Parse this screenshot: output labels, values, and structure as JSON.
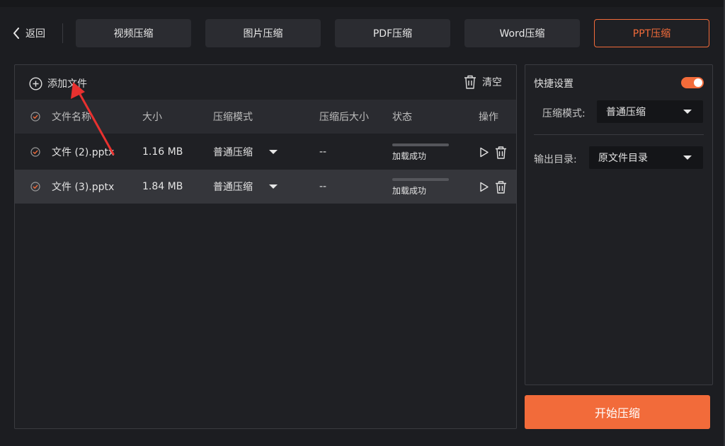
{
  "nav": {
    "back_label": "返回",
    "tabs": [
      {
        "label": "视频压缩"
      },
      {
        "label": "图片压缩"
      },
      {
        "label": "PDF压缩"
      },
      {
        "label": "Word压缩"
      },
      {
        "label": "PPT压缩"
      }
    ],
    "active_tab": "PPT压缩"
  },
  "toolbar": {
    "add_file_label": "添加文件",
    "clear_label": "清空"
  },
  "table": {
    "headers": [
      "文件名称",
      "大小",
      "压缩模式",
      "压缩后大小",
      "状态",
      "操作"
    ],
    "rows": [
      {
        "name": "文件 (2).pptx",
        "size": "1.16 MB",
        "mode": "普通压缩",
        "after_size": "--",
        "status": "加载成功"
      },
      {
        "name": "文件 (3).pptx",
        "size": "1.84 MB",
        "mode": "普通压缩",
        "after_size": "--",
        "status": "加载成功"
      }
    ]
  },
  "settings": {
    "title": "快捷设置",
    "toggle_on": true,
    "mode_label": "压缩模式:",
    "mode_value": "普通压缩",
    "output_label": "输出目录:",
    "output_value": "原文件目录"
  },
  "start_button": "开始压缩",
  "colors": {
    "accent": "#f26b3a",
    "background": "#1c1d21",
    "panel": "#1f2024",
    "annotation_arrow": "#e8312f"
  },
  "icons": {
    "back": "chevron-left-icon",
    "add": "plus-circle-icon",
    "clear": "trash-icon",
    "check": "check-circle-icon",
    "play": "play-icon",
    "delete": "trash-icon",
    "dropdown": "caret-down-icon"
  }
}
